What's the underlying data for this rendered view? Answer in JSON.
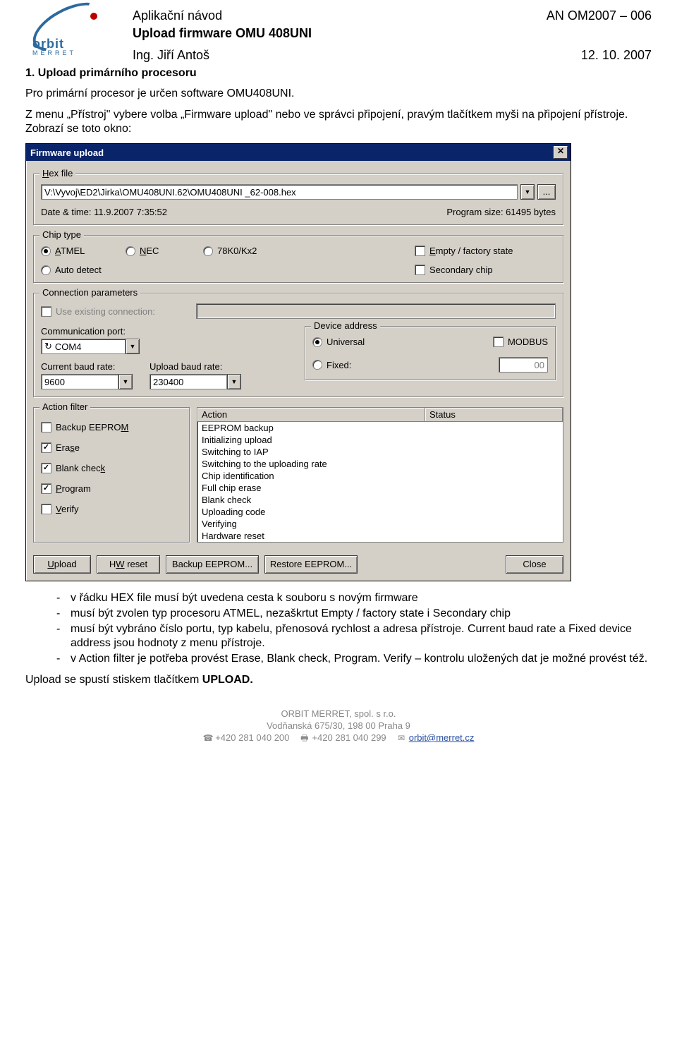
{
  "header": {
    "logo_text": "orbit",
    "logo_sub": "MERRET",
    "line1_left": "Aplikační návod",
    "line1_right": "AN  OM2007 – 006",
    "line2_left": "Upload firmware OMU 408UNI",
    "line3_left": "Ing. Jiří Antoš",
    "line3_right": "12. 10. 2007"
  },
  "section_title": "1. Upload primárního procesoru",
  "p1": "Pro primární procesor je určen software OMU408UNI.",
  "p2": "Z menu „Přístroj\" vybere volba „Firmware upload\" nebo ve správci připojení, pravým tlačítkem myši na připojení přístroje. Zobrazí se toto okno:",
  "dialog": {
    "title": "Firmware upload",
    "hex": {
      "legend": "Hex file",
      "path": "V:\\Vyvoj\\ED2\\Jirka\\OMU408UNI.62\\OMU408UNI _62-008.hex",
      "browse": "...",
      "date_label": "Date & time: 11.9.2007 7:35:52",
      "size_label": "Program size: 61495 bytes"
    },
    "chip": {
      "legend": "Chip type",
      "atmel": "ATMEL",
      "nec": "NEC",
      "k0": "78K0/Kx2",
      "auto": "Auto detect",
      "empty": "Empty / factory state",
      "secondary": "Secondary chip"
    },
    "conn": {
      "legend": "Connection parameters",
      "use_existing": "Use existing connection:",
      "comm_label": "Communication port:",
      "comm_value": "COM4",
      "refresh_icon": "↻",
      "cur_baud_label": "Current baud rate:",
      "cur_baud_value": "9600",
      "up_baud_label": "Upload baud rate:",
      "up_baud_value": "230400",
      "dev_legend": "Device address",
      "universal": "Universal",
      "fixed": "Fixed:",
      "fixed_value": "00",
      "modbus": "MODBUS"
    },
    "filter": {
      "legend": "Action filter",
      "backup": "Backup EEPROM",
      "erase": "Erase",
      "blank": "Blank check",
      "program": "Program",
      "verify": "Verify"
    },
    "actions": {
      "head_action": "Action",
      "head_status": "Status",
      "items": [
        "EEPROM backup",
        "Initializing upload",
        "Switching to IAP",
        "Switching to the uploading rate",
        "Chip identification",
        "Full chip erase",
        "Blank check",
        "Uploading code",
        "Verifying",
        "Hardware reset"
      ]
    },
    "buttons": {
      "upload": "Upload",
      "hwreset": "HW reset",
      "backup": "Backup EEPROM...",
      "restore": "Restore EEPROM...",
      "close": "Close"
    }
  },
  "bullets": [
    "v řádku HEX file musí být uvedena cesta k souboru s novým firmware",
    "musí být zvolen typ procesoru ATMEL, nezaškrtut Empty / factory state i Secondary chip",
    "musí být vybráno číslo portu, typ kabelu, přenosová rychlost a adresa přístroje. Current baud rate a Fixed device address jsou hodnoty z menu přístroje.",
    "v Action filter je potřeba provést Erase, Blank check, Program. Verify – kontrolu uložených dat je možné provést též."
  ],
  "p3": "Upload se spustí stiskem tlačítkem ",
  "p3_bold": "UPLOAD.",
  "footer": {
    "l1": "ORBIT MERRET, spol. s r.o.",
    "l2": "Vodňanská 675/30, 198 00 Praha 9",
    "tel1": "+420 281 040 200",
    "tel2": "+420 281 040 299",
    "email": "orbit@merret.cz"
  }
}
